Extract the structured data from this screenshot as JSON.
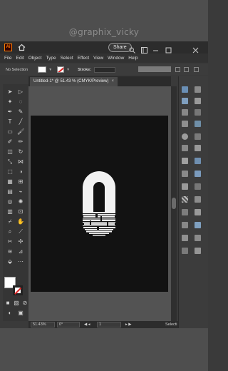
{
  "watermark": "@graphix_vicky",
  "app": {
    "logo": "Ai",
    "share_label": "Share"
  },
  "menu": [
    "File",
    "Edit",
    "Object",
    "Type",
    "Select",
    "Effect",
    "View",
    "Window",
    "Help"
  ],
  "control_bar": {
    "selection": "No Selection",
    "stroke_label": "Stroke:"
  },
  "document": {
    "tab_title": "Untitled-1* @ 51.43 % (CMYK/Preview)",
    "close": "×"
  },
  "artwork": {
    "glyph": "0",
    "background": "#121212",
    "glyph_color": "#f2f2f2"
  },
  "status_bar": {
    "zoom": "51.43%",
    "rotation": "0°",
    "artboard": "1",
    "tool": "Selecti"
  },
  "colors": {
    "accent": "#ff7c00",
    "panel": "#3c3c3c"
  }
}
